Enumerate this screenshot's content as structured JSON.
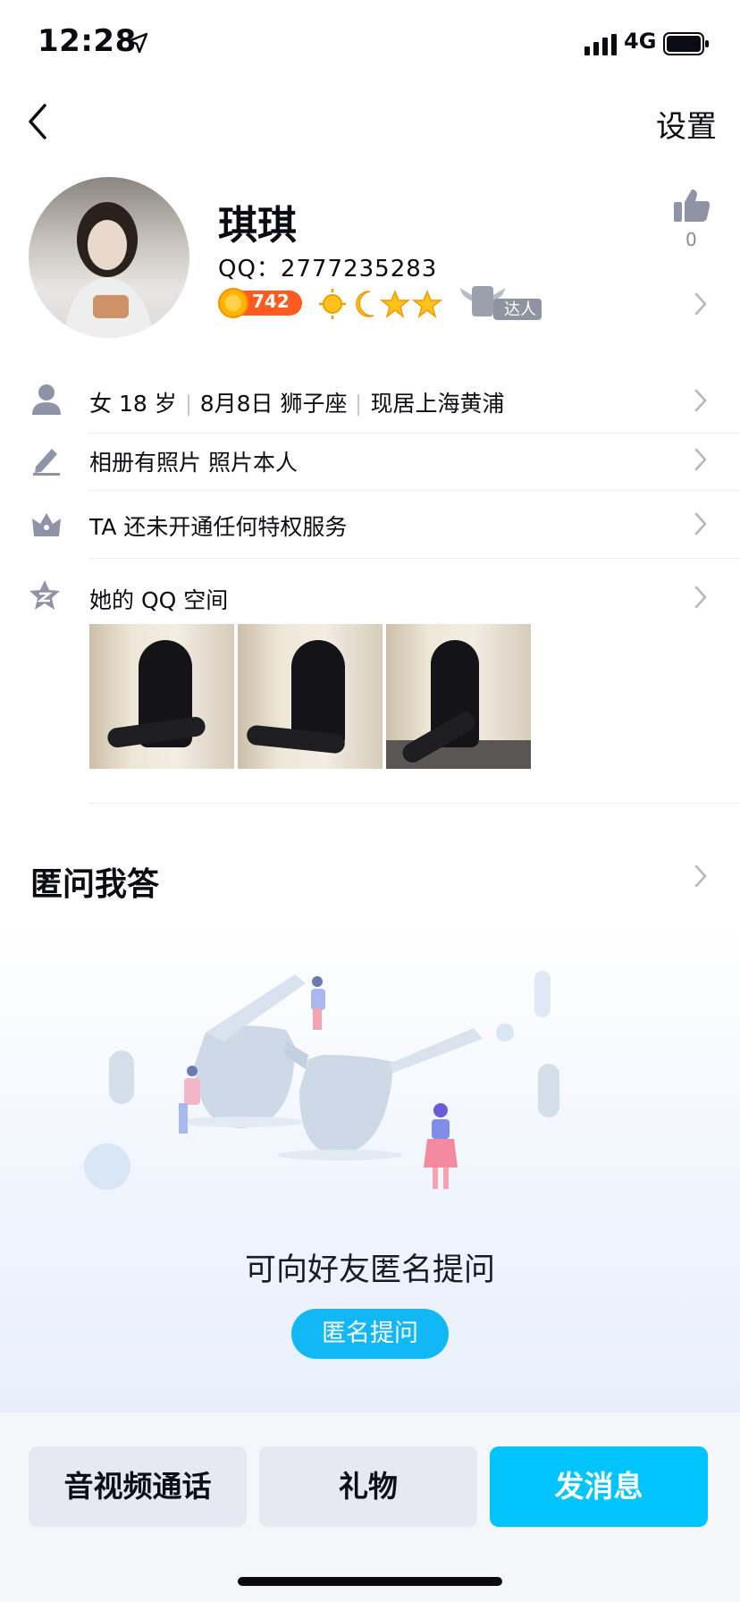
{
  "status_bar": {
    "time": "12:28",
    "network": "4G"
  },
  "nav": {
    "settings_label": "设置"
  },
  "profile": {
    "nickname": "琪琪",
    "qq_label": "QQ：2777235283",
    "coin_value": "742",
    "talent_badge": "达人",
    "like_count": "0"
  },
  "info_rows": {
    "gender_age": "女 18 岁",
    "birthday": "8月8日 狮子座",
    "location": "现居上海黄浦",
    "album": "相册有照片 照片本人",
    "privilege": "TA 还未开通任何特权服务",
    "qzone": "她的 QQ 空间"
  },
  "anon_qa": {
    "title": "匿问我答",
    "prompt": "可向好友匿名提问",
    "button_label": "匿名提问"
  },
  "bottom_actions": {
    "call": "音视频通话",
    "gift": "礼物",
    "message": "发消息"
  },
  "colors": {
    "accent": "#12b7f5",
    "message_button": "#00c4fb",
    "coin_orange": "#ff6a00"
  },
  "icons": [
    "location-arrow-icon",
    "signal-icon",
    "battery-icon",
    "back-chevron-icon",
    "thumb-up-icon",
    "coin-icon",
    "sun-level-icon",
    "moon-level-icon",
    "star-level-icon",
    "wing-badge-icon",
    "person-icon",
    "pencil-icon",
    "crown-icon",
    "qzone-star-icon",
    "chevron-right-icon"
  ]
}
